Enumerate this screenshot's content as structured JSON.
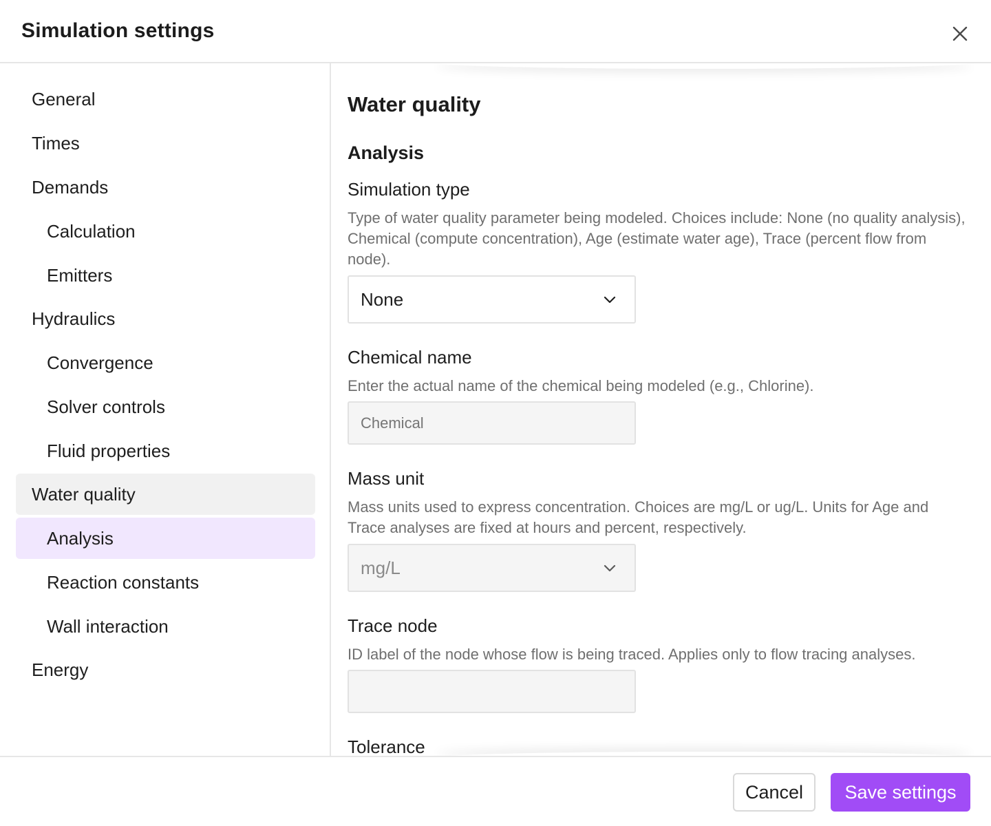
{
  "dialog": {
    "title": "Simulation settings"
  },
  "sidebar": {
    "items": [
      {
        "label": "General",
        "level": 1
      },
      {
        "label": "Times",
        "level": 1
      },
      {
        "label": "Demands",
        "level": 1
      },
      {
        "label": "Calculation",
        "level": 2
      },
      {
        "label": "Emitters",
        "level": 2
      },
      {
        "label": "Hydraulics",
        "level": 1
      },
      {
        "label": "Convergence",
        "level": 2
      },
      {
        "label": "Solver controls",
        "level": 2
      },
      {
        "label": "Fluid properties",
        "level": 2
      },
      {
        "label": "Water quality",
        "level": 1,
        "state": "group-active"
      },
      {
        "label": "Analysis",
        "level": 2,
        "state": "active"
      },
      {
        "label": "Reaction constants",
        "level": 2
      },
      {
        "label": "Wall interaction",
        "level": 2
      },
      {
        "label": "Energy",
        "level": 1
      }
    ]
  },
  "content": {
    "heading": "Water quality",
    "subheading": "Analysis",
    "fields": {
      "simulation_type": {
        "label": "Simulation type",
        "description": "Type of water quality parameter being modeled. Choices include: None (no quality analysis), Chemical (compute concentration), Age (estimate water age), Trace (percent flow from node).",
        "value": "None"
      },
      "chemical_name": {
        "label": "Chemical name",
        "description": "Enter the actual name of the chemical being modeled (e.g., Chlorine).",
        "placeholder": "Chemical"
      },
      "mass_unit": {
        "label": "Mass unit",
        "description": "Mass units used to express concentration. Choices are mg/L or ug/L. Units for Age and Trace analyses are fixed at hours and percent, respectively.",
        "value": "mg/L"
      },
      "trace_node": {
        "label": "Trace node",
        "description": "ID label of the node whose flow is being traced. Applies only to flow tracing analyses.",
        "value": ""
      },
      "tolerance": {
        "label": "Tolerance"
      }
    }
  },
  "footer": {
    "cancel_label": "Cancel",
    "save_label": "Save settings"
  },
  "colors": {
    "accent": "#a14cf6",
    "active_item_bg": "#f1e7fe",
    "group_item_bg": "#f1f1f1"
  }
}
